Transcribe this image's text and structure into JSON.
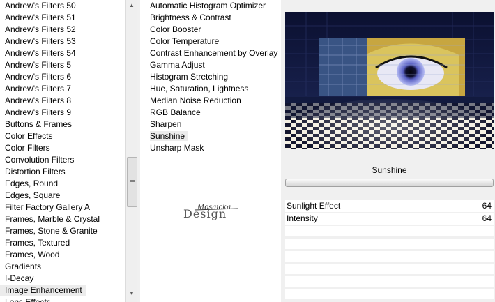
{
  "categories": [
    "Andrew's Filters 50",
    "Andrew's Filters 51",
    "Andrew's Filters 52",
    "Andrew's Filters 53",
    "Andrew's Filters 54",
    "Andrew's Filters 5",
    "Andrew's Filters 6",
    "Andrew's Filters 7",
    "Andrew's Filters 8",
    "Andrew's Filters 9",
    "Buttons & Frames",
    "Color Effects",
    "Color Filters",
    "Convolution Filters",
    "Distortion Filters",
    "Edges, Round",
    "Edges, Square",
    "Filter Factory Gallery A",
    "Frames, Marble & Crystal",
    "Frames, Stone & Granite",
    "Frames, Textured",
    "Frames, Wood",
    "Gradients",
    "I-Decay",
    "Image Enhancement",
    "Lens Effects"
  ],
  "selected_category": "Image Enhancement",
  "filters": [
    "Automatic Histogram Optimizer",
    "Brightness & Contrast",
    "Color Booster",
    "Color Temperature",
    "Contrast Enhancement by Overlay",
    "Gamma Adjust",
    "Histogram Stretching",
    "Hue, Saturation, Lightness",
    "Median Noise Reduction",
    "RGB Balance",
    "Sharpen",
    "Sunshine",
    "Unsharp Mask"
  ],
  "selected_filter": "Sunshine",
  "logo": {
    "text_top": "Mosaicka",
    "text_main": "Design"
  },
  "preview": {
    "title": "Sunshine"
  },
  "params": [
    {
      "name": "Sunlight Effect",
      "value": "64"
    },
    {
      "name": "Intensity",
      "value": "64"
    }
  ],
  "icons": {
    "scroll_up": "triangle-up",
    "scroll_down": "triangle-down",
    "scroll_grip": "grip-lines"
  },
  "colors": {
    "selection": "#ececec",
    "preview_bg": "#10163a",
    "panel_bg": "#f0f0f0"
  }
}
